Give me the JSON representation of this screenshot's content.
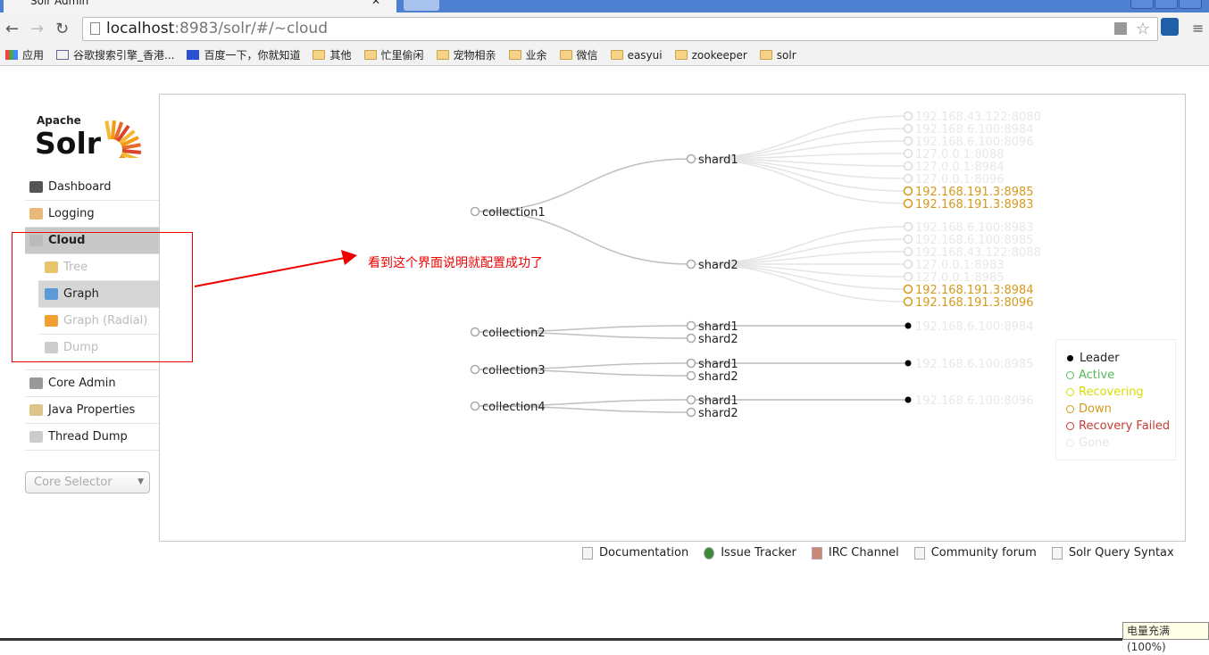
{
  "browser": {
    "tab_title": "Solr Admin",
    "url_host": "localhost",
    "url_rest": ":8983/solr/#/~cloud",
    "bookmarks": [
      "应用",
      "谷歌搜索引擎_香港...",
      "百度一下，你就知道",
      "其他",
      "忙里偷闲",
      "宠物相亲",
      "业余",
      "微信",
      "easyui",
      "zookeeper",
      "solr"
    ]
  },
  "logo": {
    "apache": "Apache",
    "solr": "Solr"
  },
  "sidebar": {
    "items": [
      {
        "label": "Dashboard",
        "icon": "dashboard-icon"
      },
      {
        "label": "Logging",
        "icon": "logging-icon"
      },
      {
        "label": "Cloud",
        "icon": "cloud-icon",
        "active": true
      },
      {
        "label": "Tree",
        "icon": "tree-icon"
      },
      {
        "label": "Graph",
        "icon": "graph-icon",
        "selected": true
      },
      {
        "label": "Graph (Radial)",
        "icon": "radial-icon"
      },
      {
        "label": "Dump",
        "icon": "dump-icon"
      },
      {
        "label": "Core Admin",
        "icon": "core-admin-icon"
      },
      {
        "label": "Java Properties",
        "icon": "java-icon"
      },
      {
        "label": "Thread Dump",
        "icon": "thread-dump-icon"
      }
    ],
    "core_selector": "Core Selector"
  },
  "annotation": "看到这个界面说明就配置成功了",
  "colors": {
    "leader": "#000000",
    "active": "#57b757",
    "recovering": "#d5dd00",
    "down": "#d39a1d",
    "recovery_failed": "#c43c35",
    "gone": "#e6e6e6",
    "annotation": "#ee0000"
  },
  "graph": {
    "collections": [
      {
        "name": "collection1",
        "shards": [
          {
            "name": "shard1",
            "replicas": [
              {
                "name": "192.168.43.122:8080",
                "state": "gone"
              },
              {
                "name": "192.168.6.100:8984",
                "state": "gone"
              },
              {
                "name": "192.168.6.100:8096",
                "state": "gone"
              },
              {
                "name": "127.0.0.1:8088",
                "state": "gone"
              },
              {
                "name": "127.0.0.1:8984",
                "state": "gone"
              },
              {
                "name": "127.0.0.1:8096",
                "state": "gone"
              },
              {
                "name": "192.168.191.3:8985",
                "state": "down"
              },
              {
                "name": "192.168.191.3:8983",
                "state": "down"
              }
            ]
          },
          {
            "name": "shard2",
            "replicas": [
              {
                "name": "192.168.6.100:8983",
                "state": "gone"
              },
              {
                "name": "192.168.6.100:8985",
                "state": "gone"
              },
              {
                "name": "192.168.43.122:8088",
                "state": "gone"
              },
              {
                "name": "127.0.0.1:8983",
                "state": "gone"
              },
              {
                "name": "127.0.0.1:8985",
                "state": "gone"
              },
              {
                "name": "192.168.191.3:8984",
                "state": "down"
              },
              {
                "name": "192.168.191.3:8096",
                "state": "down"
              }
            ]
          }
        ]
      },
      {
        "name": "collection2",
        "shards": [
          {
            "name": "shard1",
            "replicas": [
              {
                "name": "192.168.6.100:8984",
                "state": "gone",
                "leader": true
              }
            ]
          },
          {
            "name": "shard2",
            "replicas": []
          }
        ]
      },
      {
        "name": "collection3",
        "shards": [
          {
            "name": "shard1",
            "replicas": [
              {
                "name": "192.168.6.100:8985",
                "state": "gone",
                "leader": true
              }
            ]
          },
          {
            "name": "shard2",
            "replicas": []
          }
        ]
      },
      {
        "name": "collection4",
        "shards": [
          {
            "name": "shard1",
            "replicas": [
              {
                "name": "192.168.6.100:8096",
                "state": "gone",
                "leader": true
              }
            ]
          },
          {
            "name": "shard2",
            "replicas": []
          }
        ]
      }
    ]
  },
  "legend": [
    {
      "label": "Leader",
      "key": "leader"
    },
    {
      "label": "Active",
      "key": "active"
    },
    {
      "label": "Recovering",
      "key": "recovering"
    },
    {
      "label": "Down",
      "key": "down"
    },
    {
      "label": "Recovery Failed",
      "key": "recovery_failed"
    },
    {
      "label": "Gone",
      "key": "gone"
    }
  ],
  "footer": [
    "Documentation",
    "Issue Tracker",
    "IRC Channel",
    "Community forum",
    "Solr Query Syntax"
  ],
  "battery": "电量充满(100%)"
}
